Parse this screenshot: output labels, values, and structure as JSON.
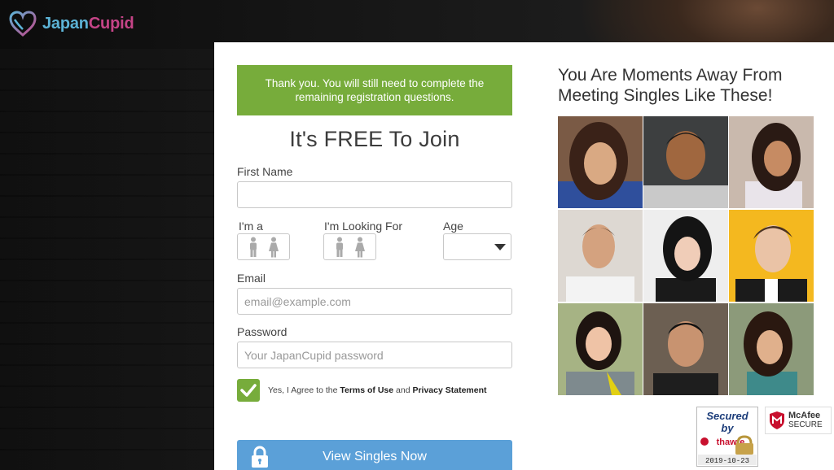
{
  "brand": {
    "name_part1": "Japan",
    "name_part2": "Cupid"
  },
  "form": {
    "banner": "Thank you. You will still need to complete the remaining registration questions.",
    "heading": "It's FREE To Join",
    "first_name": {
      "label": "First Name",
      "value": "",
      "placeholder": ""
    },
    "im_a": {
      "label": "I'm a"
    },
    "looking_for": {
      "label": "I'm Looking For"
    },
    "age": {
      "label": "Age",
      "value": ""
    },
    "email": {
      "label": "Email",
      "placeholder": "email@example.com"
    },
    "password": {
      "label": "Password",
      "placeholder": "Your JapanCupid password"
    },
    "agree": {
      "prefix": "Yes, I Agree to the ",
      "terms": "Terms of Use",
      "and": " and ",
      "privacy": "Privacy Statement",
      "checked": true
    },
    "submit": "View Singles Now"
  },
  "promo": {
    "title": "You Are Moments Away From Meeting Singles Like These!",
    "photos": [
      "woman-1",
      "man-1",
      "woman-2",
      "man-2",
      "woman-3",
      "man-3",
      "woman-4",
      "man-4",
      "woman-5"
    ]
  },
  "badges": {
    "thawte": {
      "line1": "Secured",
      "line2": "by",
      "brand": "thawte",
      "date": "2019-10-23"
    },
    "mcafee": {
      "line1": "McAfee",
      "line2": "SECURE"
    }
  },
  "colors": {
    "accent_green": "#77ac3b",
    "cta_blue": "#5ba0d8",
    "logo_blue": "#5cb3d6",
    "logo_pink": "#c54487"
  }
}
